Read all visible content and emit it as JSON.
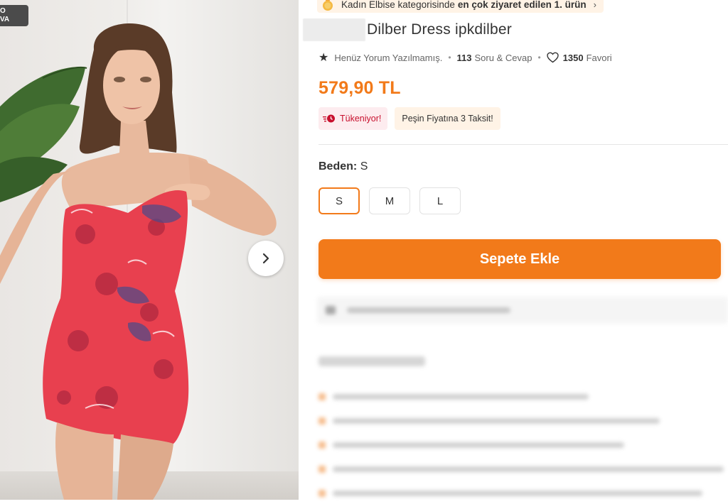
{
  "gallery": {
    "video_badge": [
      "O",
      "VA"
    ],
    "next_icon": "chevron-right-icon"
  },
  "banner": {
    "prefix": "Kadın Elbise kategorisinde",
    "highlight": "en çok ziyaret edilen 1. ürün",
    "chevron": "›",
    "icon": "medal-icon"
  },
  "product": {
    "name": "Dilber Dress ipkdilber",
    "price": "579,90 TL"
  },
  "meta": {
    "reviews_text": "Henüz Yorum Yazılmamış.",
    "qa_count": "113",
    "qa_label": "Soru & Cevap",
    "fav_count": "1350",
    "fav_label": "Favori",
    "dot": "•"
  },
  "tags": {
    "stock": "Tükeniyor!",
    "installment": "Peşin Fiyatına 3 Taksit!"
  },
  "size": {
    "label": "Beden:",
    "selected": "S",
    "options": [
      "S",
      "M",
      "L"
    ]
  },
  "cart": {
    "button_label": "Sepete Ekle"
  },
  "colors": {
    "accent": "#f27a1a",
    "stock_red": "#c8102e"
  }
}
